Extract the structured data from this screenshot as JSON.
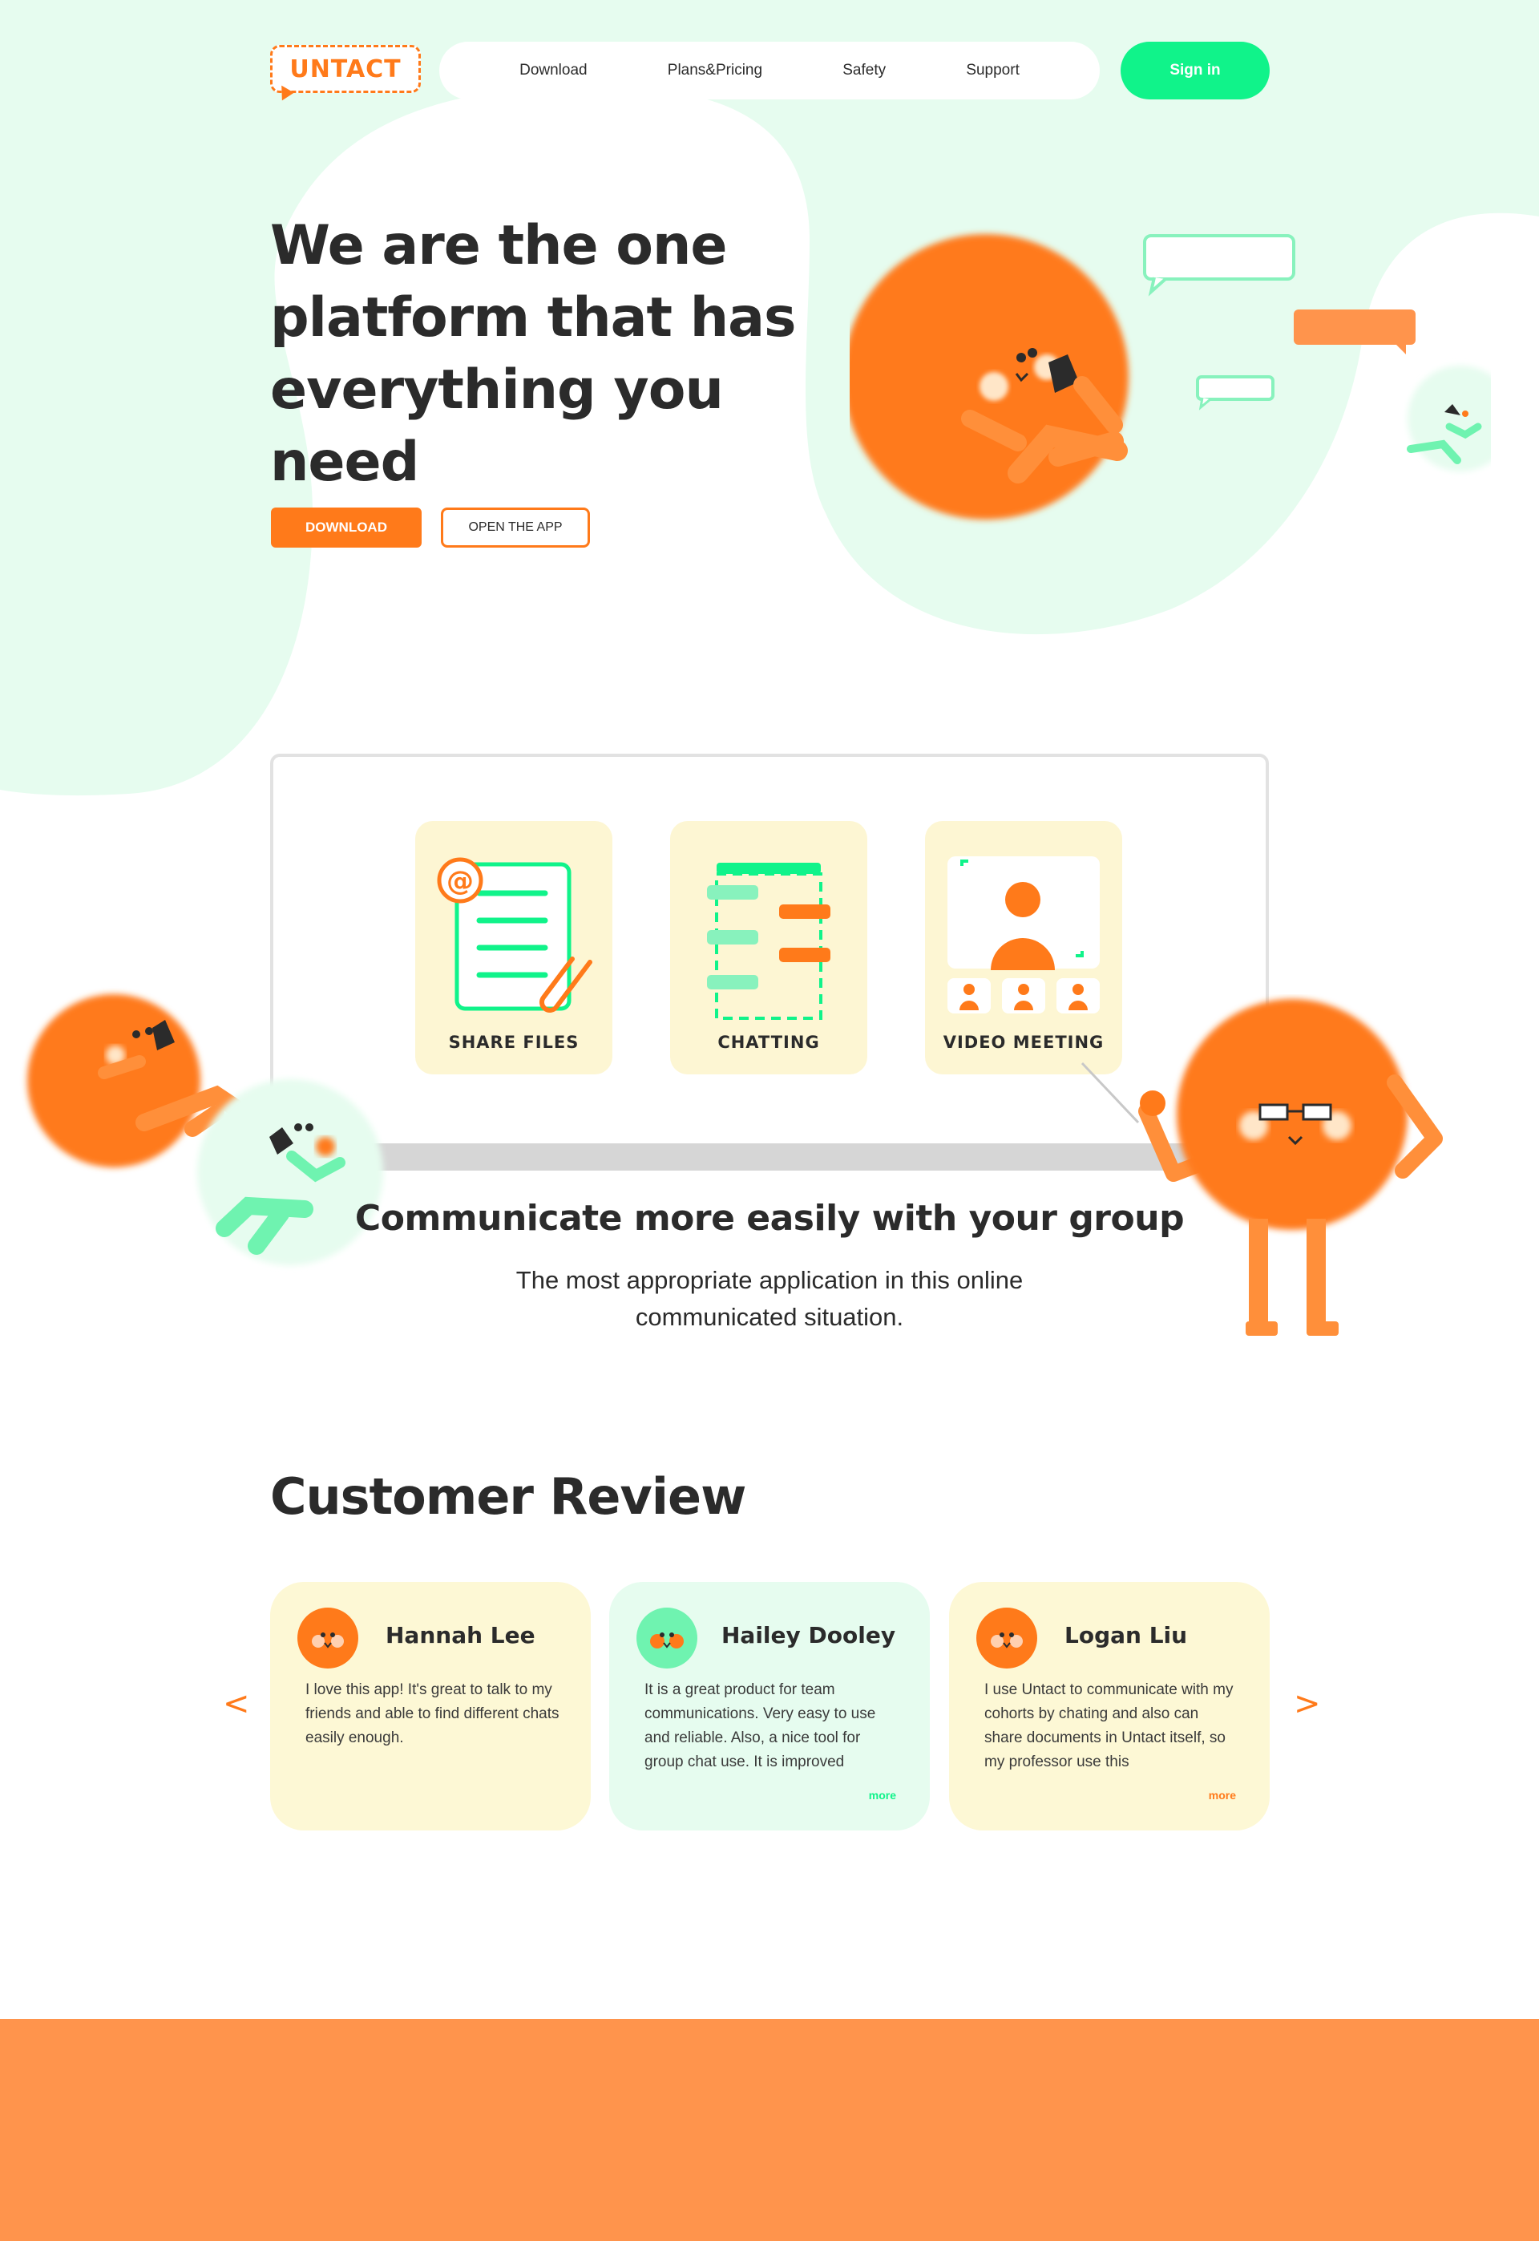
{
  "brand": {
    "logo_text": "UNTACT"
  },
  "nav": {
    "items": [
      {
        "label": "Download"
      },
      {
        "label": "Plans&Pricing"
      },
      {
        "label": "Safety"
      },
      {
        "label": "Support"
      }
    ],
    "signin_label": "Sign in"
  },
  "hero": {
    "title_lines": [
      "We are the one",
      "platform that has",
      "everything you need"
    ],
    "download_label": "DOWNLOAD",
    "open_app_label": "OPEN THE APP"
  },
  "features": {
    "items": [
      {
        "label": "SHARE FILES",
        "icon": "document-icon"
      },
      {
        "label": "CHATTING",
        "icon": "chat-icon"
      },
      {
        "label": "VIDEO MEETING",
        "icon": "video-meeting-icon"
      }
    ],
    "heading": "Communicate more easily with your group",
    "subtext_lines": [
      "The most appropriate application in this online",
      "communicated situation."
    ]
  },
  "reviews": {
    "heading": "Customer Review",
    "prev_label": "<",
    "next_label": ">",
    "cards": [
      {
        "name": "Hannah Lee",
        "text": "I love this app! It's great to talk to my friends and able to find different chats easily enough.",
        "more": ""
      },
      {
        "name": "Hailey Dooley",
        "text": "It is a great product for team communications. Very easy to use and reliable. Also, a nice tool for group chat use. It is improved",
        "more": "more"
      },
      {
        "name": "Logan Liu",
        "text": "I use Untact to communicate with my cohorts by chating and also can share documents in Untact itself, so my professor use this",
        "more": "more"
      }
    ]
  },
  "colors": {
    "accent": "#ff7a1a",
    "green": "#10f38a",
    "mint_bg": "#e6fcef",
    "cream": "#fdf6d3",
    "footer": "#ff944c"
  }
}
